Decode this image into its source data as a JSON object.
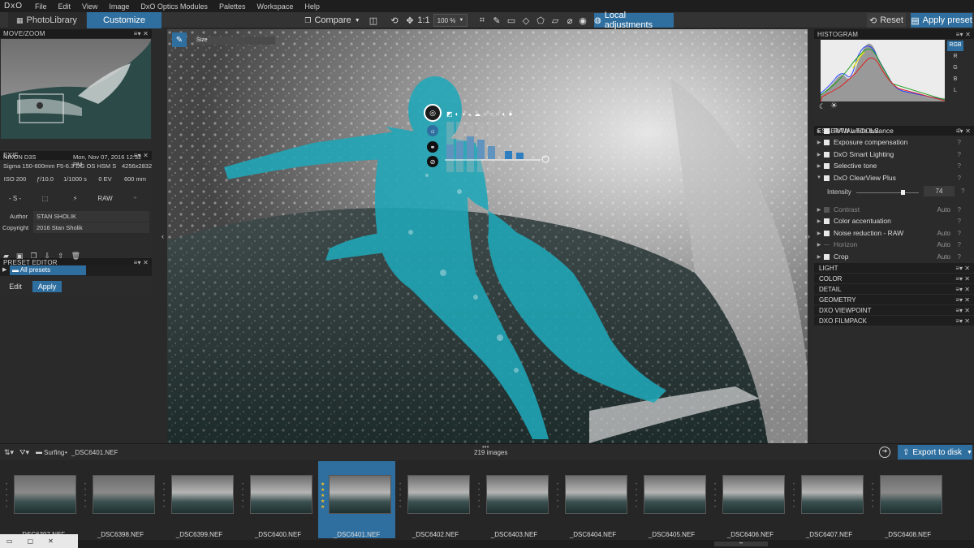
{
  "app": {
    "logo": "DxO"
  },
  "menu": [
    "File",
    "Edit",
    "View",
    "Image",
    "DxO Optics Modules",
    "Palettes",
    "Workspace",
    "Help"
  ],
  "tabs": {
    "photolibrary": "PhotoLibrary",
    "customize": "Customize"
  },
  "toolbar": {
    "compare": "Compare",
    "one_to_one": "1:1",
    "zoom": "100 %",
    "local_adjustments": "Local adjustments",
    "reset": "Reset",
    "apply_preset": "Apply preset"
  },
  "move_zoom": {
    "title": "MOVE/ZOOM"
  },
  "exif": {
    "title": "EXIF",
    "camera": "NIKON D3S",
    "date": "Mon, Nov 07, 2016 12:32 PM",
    "lens": "Sigma 150-600mm F5-6.3 DG OS HSM S",
    "dimensions": "4256x2832",
    "iso": "ISO 200",
    "aperture": "ƒ/10.0",
    "shutter": "1/1000 s",
    "ev": "0 EV",
    "focal": "600 mm",
    "mode": "- S -",
    "format": "RAW",
    "author_label": "Author",
    "author": "STAN SHOLIK",
    "copyright_label": "Copyright",
    "copyright": "2016 Stan Sholik"
  },
  "preset_editor": {
    "title": "PRESET EDITOR",
    "all_presets": "All presets",
    "edit": "Edit",
    "apply": "Apply"
  },
  "canvas": {
    "size_label": "Size"
  },
  "histogram": {
    "title": "HISTOGRAM",
    "channels": [
      "RGB",
      "R",
      "G",
      "B",
      "L"
    ]
  },
  "essential_tools": {
    "title": "ESSENTIAL TOOLS",
    "items": [
      {
        "label": "RAW white balance",
        "auto": "",
        "enabled": true
      },
      {
        "label": "Exposure compensation",
        "auto": "",
        "enabled": true
      },
      {
        "label": "DxO Smart Lighting",
        "auto": "",
        "enabled": true
      },
      {
        "label": "Selective tone",
        "auto": "",
        "enabled": true
      },
      {
        "label": "DxO ClearView Plus",
        "auto": "",
        "enabled": true
      }
    ],
    "intensity_label": "Intensity",
    "intensity_value": "74",
    "intensity_fraction": 0.74,
    "items2": [
      {
        "label": "Contrast",
        "auto": "Auto",
        "enabled": false
      },
      {
        "label": "Color accentuation",
        "auto": "",
        "enabled": true
      },
      {
        "label": "Noise reduction - RAW",
        "auto": "Auto",
        "enabled": true
      },
      {
        "label": "Horizon",
        "auto": "Auto",
        "enabled": false
      },
      {
        "label": "Crop",
        "auto": "Auto",
        "enabled": true
      }
    ]
  },
  "sections": [
    "LIGHT",
    "COLOR",
    "DETAIL",
    "GEOMETRY",
    "DXO VIEWPOINT",
    "DXO FILMPACK"
  ],
  "filmstrip": {
    "breadcrumb_folder": "Surfing",
    "breadcrumb_file": "_DSC6401.NEF",
    "count": "219 images",
    "export": "Export to disk",
    "selected_index": 4,
    "thumbs": [
      "_DSC6397.NEF",
      "_DSC6398.NEF",
      "_DSC6399.NEF",
      "_DSC6400.NEF",
      "_DSC6401.NEF",
      "_DSC6402.NEF",
      "_DSC6403.NEF",
      "_DSC6404.NEF",
      "_DSC6405.NEF",
      "_DSC6406.NEF",
      "_DSC6407.NEF",
      "_DSC6408.NEF"
    ]
  },
  "colors": {
    "accent": "#2d7fb8",
    "mask": "#1fa7b8",
    "tab_active": "#2f6f9f"
  }
}
